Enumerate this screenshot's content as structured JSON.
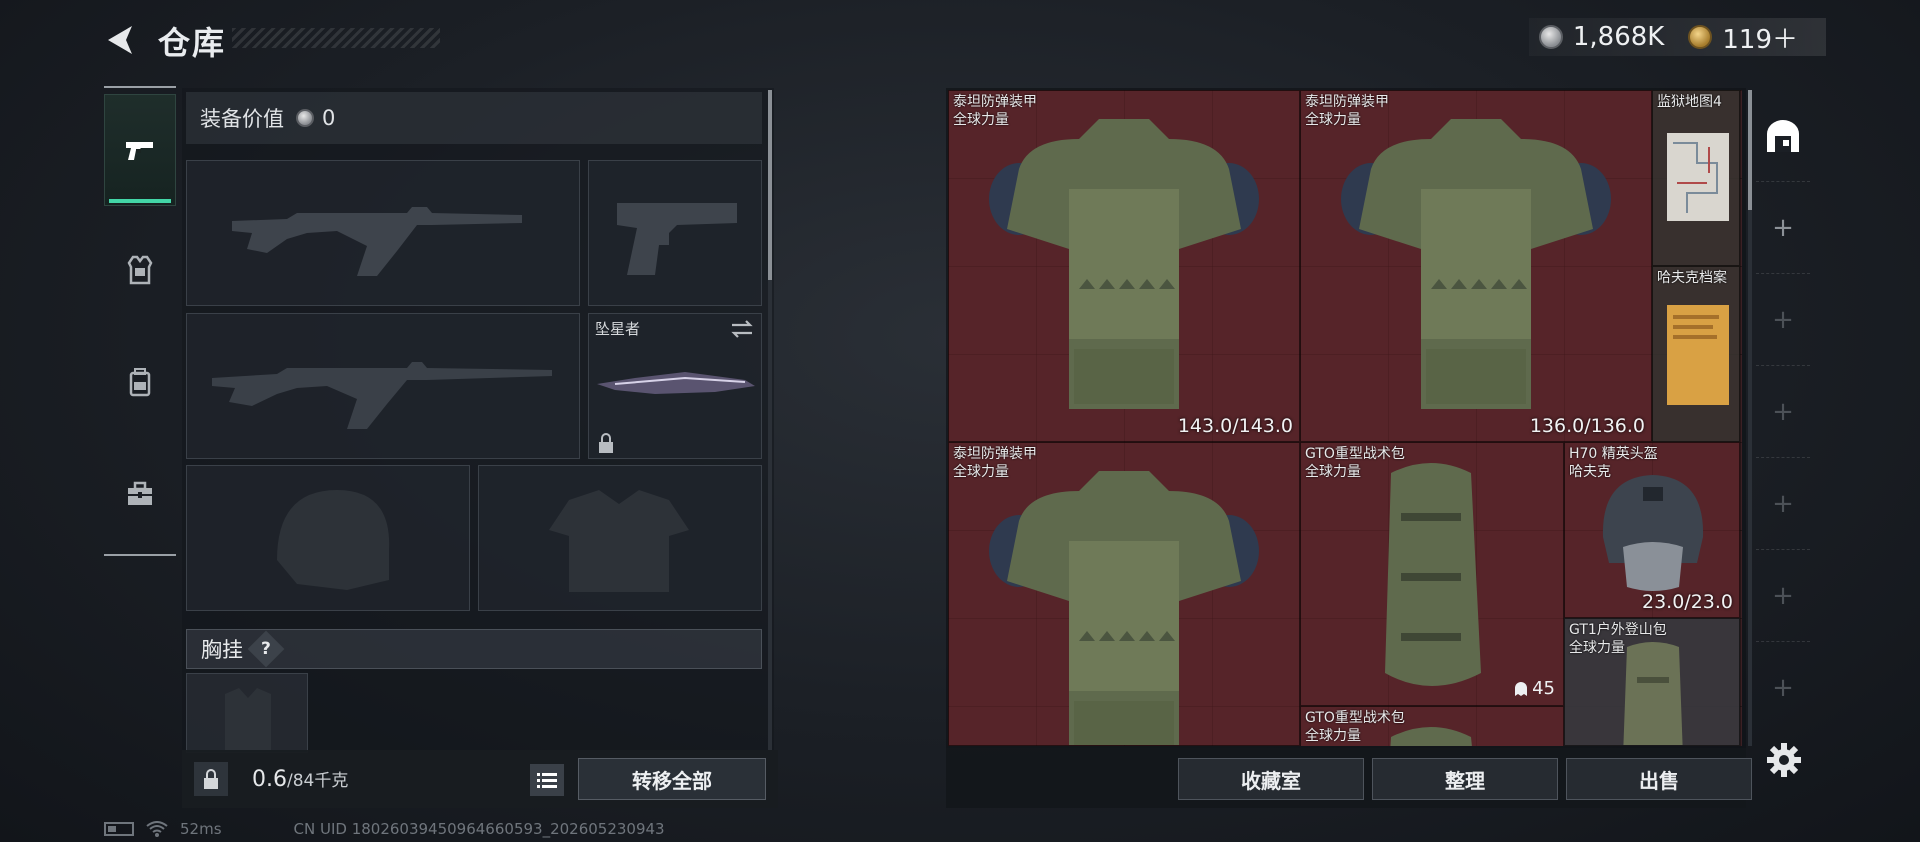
{
  "header": {
    "title": "仓库",
    "currencies": [
      {
        "icon": "silver-coin-icon",
        "value": "1,868K"
      },
      {
        "icon": "gold-coin-icon",
        "value": "119＋"
      }
    ]
  },
  "sidebar": {
    "items": [
      {
        "icon": "pistol-icon",
        "active": true
      },
      {
        "icon": "armor-icon",
        "active": false
      },
      {
        "icon": "backpack-icon",
        "active": false
      },
      {
        "icon": "toolbox-icon",
        "active": false
      }
    ]
  },
  "loadout": {
    "value_label": "装备价值",
    "value": "0",
    "melee_slot_label": "坠星者",
    "chest_rig_label": "胸挂",
    "help": "?",
    "weight_value": "0.6",
    "weight_capacity": "/84千克",
    "transfer_all": "转移全部"
  },
  "stash": {
    "items": [
      {
        "name": "泰坦防弹装甲\n全球力量",
        "durability": "143.0/143.0",
        "kind": "armor"
      },
      {
        "name": "泰坦防弹装甲\n全球力量",
        "durability": "136.0/136.0",
        "kind": "armor"
      },
      {
        "name": "监狱地图4",
        "kind": "map"
      },
      {
        "name": "哈夫克档案",
        "kind": "file"
      },
      {
        "name": "泰坦防弹装甲\n全球力量",
        "kind": "armor"
      },
      {
        "name": "GTO重型战术包\n全球力量",
        "count": "45",
        "kind": "bag"
      },
      {
        "name": "H70 精英头盔\n哈夫克",
        "durability": "23.0/23.0",
        "kind": "helmet"
      },
      {
        "name": "GT1户外登山包\n全球力量",
        "kind": "bag"
      },
      {
        "name": "GTO重型战术包\n全球力量",
        "kind": "bag"
      }
    ],
    "actions": [
      "收藏室",
      "整理",
      "出售"
    ]
  },
  "status_bar": {
    "ping": "52ms",
    "uid": "CN UID 1802603945096466059​3_202605230943"
  },
  "colors": {
    "accent": "#43d6a7",
    "grid_red": "#6e282e"
  }
}
